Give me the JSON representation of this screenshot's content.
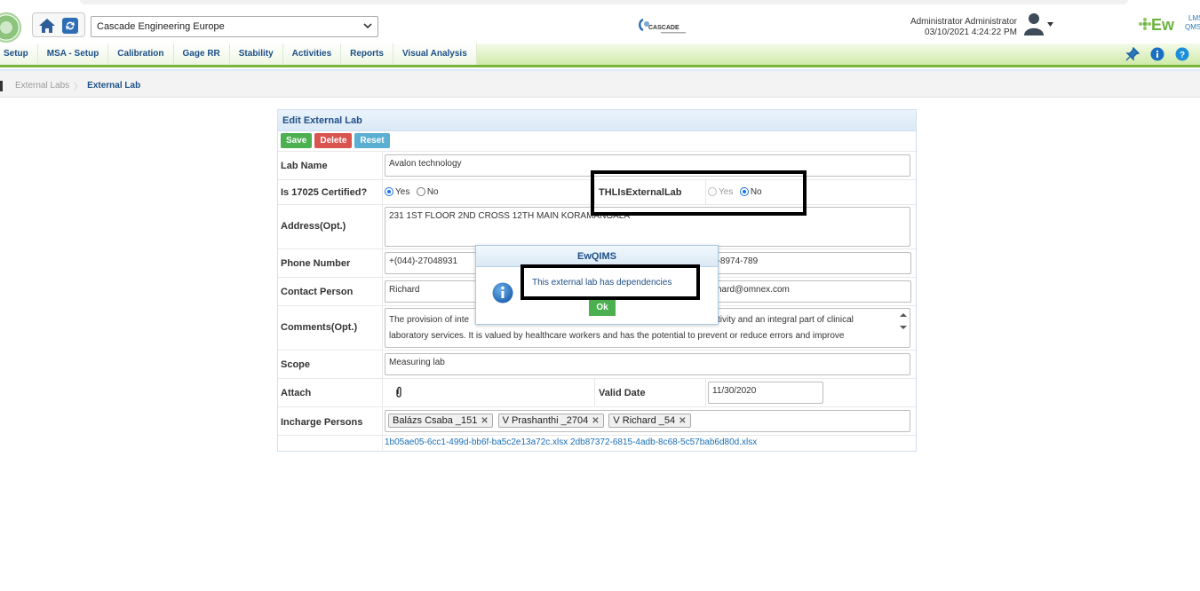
{
  "header": {
    "company_select": "Cascade Engineering Europe",
    "cascade_logo_text": "CASCADE",
    "user_name": "Administrator Administrator",
    "datetime": "03/10/2021 4:24:22 PM",
    "app_logo": {
      "main": "Ew",
      "sup": "LMS",
      "sub": "QMS"
    }
  },
  "nav": {
    "items": [
      "Setup",
      "MSA - Setup",
      "Calibration",
      "Gage RR",
      "Stability",
      "Activities",
      "Reports",
      "Visual Analysis"
    ]
  },
  "breadcrumb": {
    "parent": "External Labs",
    "current": "External Lab"
  },
  "form": {
    "title": "Edit External Lab",
    "buttons": {
      "save": "Save",
      "delete": "Delete",
      "reset": "Reset"
    },
    "labels": {
      "lab_name": "Lab Name",
      "certified": "Is 17025 Certified?",
      "th_external": "THLIsExternalLab",
      "address": "Address(Opt.)",
      "phone": "Phone Number",
      "contact": "Contact Person",
      "comments": "Comments(Opt.)",
      "scope": "Scope",
      "attach": "Attach",
      "valid_date": "Valid Date",
      "incharge": "Incharge Persons"
    },
    "values": {
      "lab_name": "Avalon technology",
      "certified_yes": "Yes",
      "certified_no": "No",
      "th_yes": "Yes",
      "th_no": "No",
      "address": "231 1ST FLOOR 2ND CROSS 12TH MAIN KORAMANGALA",
      "phone": "+(044)-27048931",
      "phone2": "0-8974-789",
      "contact": "Richard",
      "email": "chard@omnex.com",
      "comments_line1": "The provision of inte",
      "comments_line1b": "ctivity and an integral part of clinical",
      "comments_line2": "laboratory services. It is valued by healthcare workers and has the potential to prevent or reduce errors and improve",
      "scope": "Measuring lab",
      "valid_date": "11/30/2020",
      "attachments": "1b05ae05-6cc1-499d-bb6f-ba5c2e13a72c.xlsx 2db87372-6815-4adb-8c68-5c57bab6d80d.xlsx"
    },
    "incharge_tags": [
      "Balázs Csaba _151",
      "V Prashanthi _2704",
      "V Richard _54"
    ]
  },
  "dialog": {
    "title": "EwQIMS",
    "message": "This external lab has dependencies",
    "ok": "Ok"
  },
  "colors": {
    "accent_green": "#4caf50",
    "delete_red": "#d9534f",
    "reset_blue": "#5bafd3",
    "nav_green": "#79b43c"
  }
}
